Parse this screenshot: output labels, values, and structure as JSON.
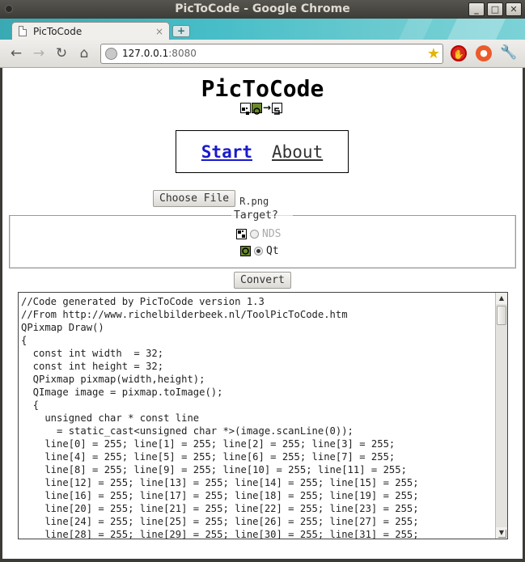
{
  "window": {
    "title": "PicToCode - Google Chrome",
    "controls": [
      "_",
      "□",
      "✕"
    ]
  },
  "tabs": [
    {
      "label": "PicToCode",
      "close": "×"
    }
  ],
  "newtab_label": "+",
  "toolbar": {
    "url_host": "127.0.0.1",
    "url_port": ":8080",
    "icons": [
      "back-icon",
      "forward-icon",
      "reload-icon",
      "home-icon",
      "star-icon",
      "adblock-icon",
      "extension-icon",
      "wrench-icon"
    ]
  },
  "page": {
    "title": "PicToCode",
    "logo_icons": [
      "nds-pixel-icon",
      "qt-icon",
      "arrow-icon",
      "s-icon"
    ],
    "nav": {
      "start": "Start",
      "about": "About"
    },
    "file": {
      "button": "Choose File",
      "filename": "R.png"
    },
    "target": {
      "legend": "Target?",
      "options": [
        {
          "label": "NDS",
          "checked": false,
          "enabled": false
        },
        {
          "label": "Qt",
          "checked": true,
          "enabled": true
        }
      ]
    },
    "convert_button": "Convert",
    "code_lines": [
      "//Code generated by PicToCode version 1.3",
      "//From http://www.richelbilderbeek.nl/ToolPicToCode.htm",
      "QPixmap Draw()",
      "{",
      "  const int width  = 32;",
      "  const int height = 32;",
      "  QPixmap pixmap(width,height);",
      "  QImage image = pixmap.toImage();",
      "  {",
      "    unsigned char * const line",
      "      = static_cast<unsigned char *>(image.scanLine(0));",
      "    line[0] = 255; line[1] = 255; line[2] = 255; line[3] = 255;",
      "    line[4] = 255; line[5] = 255; line[6] = 255; line[7] = 255;",
      "    line[8] = 255; line[9] = 255; line[10] = 255; line[11] = 255;",
      "    line[12] = 255; line[13] = 255; line[14] = 255; line[15] = 255;",
      "    line[16] = 255; line[17] = 255; line[18] = 255; line[19] = 255;",
      "    line[20] = 255; line[21] = 255; line[22] = 255; line[23] = 255;",
      "    line[24] = 255; line[25] = 255; line[26] = 255; line[27] = 255;",
      "    line[28] = 255; line[29] = 255; line[30] = 255; line[31] = 255;"
    ]
  },
  "colors": {
    "link": "#1a1acc",
    "tabstrip": "#46bdc7",
    "titlebar": "#3d3c38"
  }
}
